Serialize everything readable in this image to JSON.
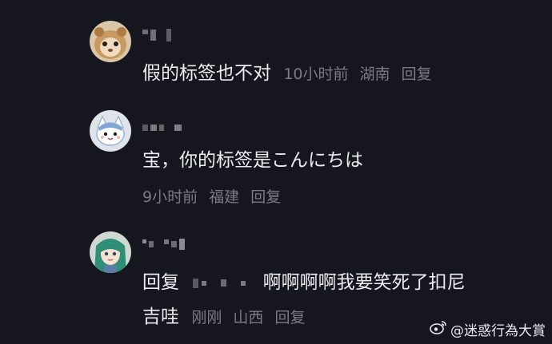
{
  "comments": [
    {
      "text": "假的标签也不对",
      "time": "10小时前",
      "location": "湖南",
      "reply_label": "回复"
    },
    {
      "text": "宝，你的标签是こんにちは",
      "time": "9小时前",
      "location": "福建",
      "reply_label": "回复"
    },
    {
      "prefix": "回复",
      "text_line1": "啊啊啊啊我要笑死了扣尼",
      "text_line2": "吉哇",
      "time": "刚刚",
      "location": "山西",
      "reply_label": "回复"
    }
  ],
  "watermark": {
    "text": "@迷惑行為大賞",
    "icon": "weibo-icon"
  },
  "colors": {
    "background": "#16161e",
    "text": "#ececf0",
    "meta": "#7b7b86"
  }
}
